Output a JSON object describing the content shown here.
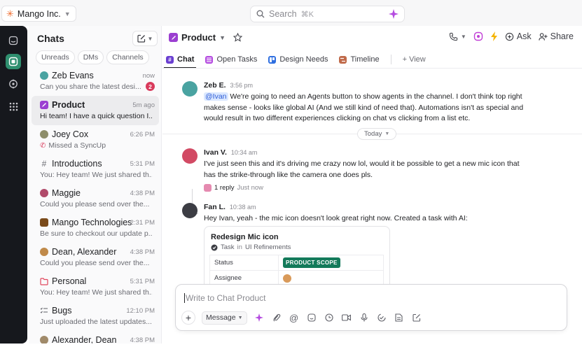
{
  "topbar": {
    "workspace": "Mango Inc.",
    "search_placeholder": "Search",
    "search_shortcut": "⌘K"
  },
  "sidebar": {
    "title": "Chats",
    "filters": [
      "Unreads",
      "DMs",
      "Channels"
    ],
    "chats": [
      {
        "name": "Zeb Evans",
        "time": "now",
        "preview": "Can you share the latest desi...",
        "badge": "2",
        "avatar_color": "#4aa3a1"
      },
      {
        "name": "Product",
        "time": "5m ago",
        "preview": "Hi team! I have a quick question I...",
        "avatar_color": "#9b3fd1"
      },
      {
        "name": "Joey Cox",
        "time": "6:26 PM",
        "preview": "Missed a SyncUp",
        "avatar_color": "#8e8e6a"
      },
      {
        "name": "Introductions",
        "time": "5:31 PM",
        "preview": "You: Hey team! We just shared th..."
      },
      {
        "name": "Maggie",
        "time": "4:38 PM",
        "preview": "Could you please send over the...",
        "avatar_color": "#b04a6a"
      },
      {
        "name": "Mango Technologies",
        "time": "2:31 PM",
        "preview": "Be sure to checkout our update p...",
        "avatar_color": "#7a4a1a"
      },
      {
        "name": "Dean, Alexander",
        "time": "4:38 PM",
        "preview": "Could you please send over the...",
        "avatar_color": "#c08a4a"
      },
      {
        "name": "Personal",
        "time": "5:31 PM",
        "preview": "You: Hey team! We just shared th...",
        "avatar_color": "#e0475e"
      },
      {
        "name": "Bugs",
        "time": "12:10 PM",
        "preview": "Just uploaded the latest updates..."
      },
      {
        "name": "Alexander, Dean",
        "time": "4:38 PM",
        "preview": "",
        "avatar_color": "#a08a6a"
      }
    ]
  },
  "header": {
    "channel": "Product",
    "ask": "Ask",
    "share": "Share",
    "tabs": [
      "Chat",
      "Open Tasks",
      "Design Needs",
      "Timeline",
      "+ View"
    ]
  },
  "messages": [
    {
      "author": "Zeb E.",
      "time": "3:56 pm",
      "mention": "@Ivan",
      "text": " We're going to need an Agents button to show agents in the channel. I don't think top right makes sense - looks like global AI (And we still kind of need that). Automations isn't as special and would result in two different experiences clicking on chat vs clicking from a list etc."
    },
    {
      "author": "Ivan V.",
      "time": "10:34 am",
      "text": "I've just seen this and it's driving me crazy now lol, would it be possible to get a new mic icon that has the strike-through like the camera one does pls.",
      "reply_count": "1 reply",
      "reply_time": "Just now"
    },
    {
      "author": "Fan L.",
      "time": "10:38 am",
      "text": "Hey Ivan, yeah - the mic icon doesn't look great right now. Created a task with AI:"
    }
  ],
  "divider_label": "Today",
  "task": {
    "title": "Redesign Mic icon",
    "type": "Task",
    "in": "in",
    "list": "UI Refinements",
    "status_label": "Status",
    "status_value": "PRODUCT SCOPE",
    "assignee_label": "Assignee"
  },
  "composer": {
    "placeholder": "Write to Chat Product",
    "mode": "Message"
  },
  "colors": {
    "rail": "#16181d",
    "rail_active": "#2f8f6f",
    "status_pill": "#137a5a",
    "badge": "#d93b5c",
    "channel_icon": "#9b3fd1"
  }
}
